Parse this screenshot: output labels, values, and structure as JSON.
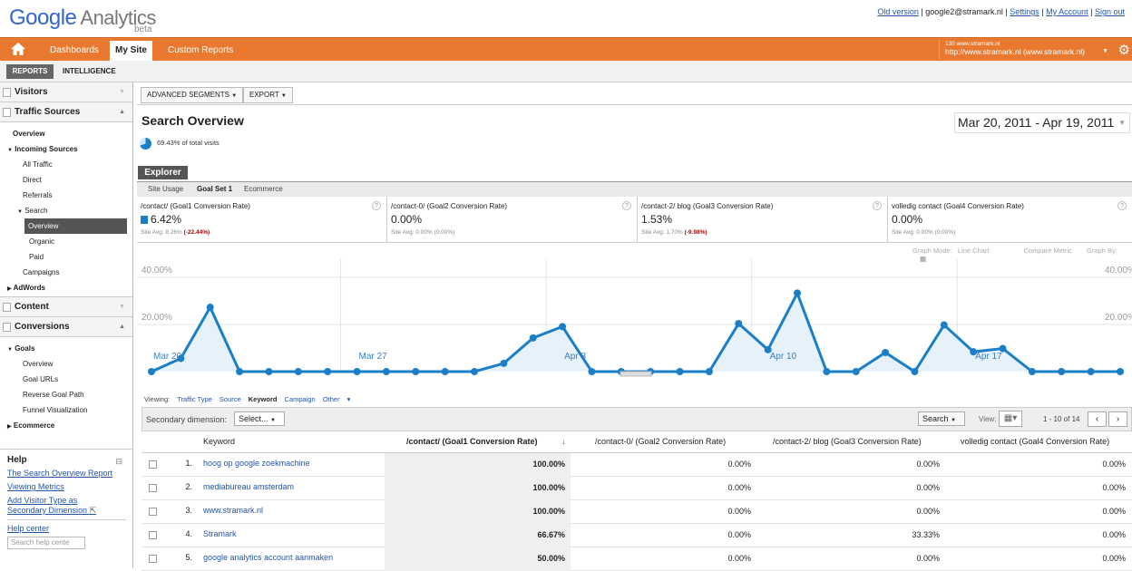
{
  "app": {
    "logo_google": "Google",
    "logo_analytics": "Analytics",
    "logo_beta": "beta"
  },
  "toplinks": {
    "old_version": "Old version",
    "email": "google2@stramark.nl",
    "settings": "Settings",
    "my_account": "My Account",
    "sign_out": "Sign out"
  },
  "nav": {
    "dashboards": "Dashboards",
    "my_site": "My Site",
    "custom_reports": "Custom Reports",
    "account_small": "130 www.stramark.nl",
    "account_big": "http://www.stramark.nl (www.stramark.nl)"
  },
  "subnav": {
    "reports": "REPORTS",
    "intelligence": "INTELLIGENCE"
  },
  "sidebar": {
    "visitors": "Visitors",
    "traffic_sources": "Traffic Sources",
    "overview": "Overview",
    "incoming_sources": "Incoming Sources",
    "all_traffic": "All Traffic",
    "direct": "Direct",
    "referrals": "Referrals",
    "search": "Search",
    "search_overview": "Overview",
    "organic": "Organic",
    "paid": "Paid",
    "campaigns": "Campaigns",
    "adwords": "AdWords",
    "content": "Content",
    "conversions": "Conversions",
    "goals": "Goals",
    "goals_overview": "Overview",
    "goal_urls": "Goal URLs",
    "reverse_goal_path": "Reverse Goal Path",
    "funnel_visualization": "Funnel Visualization",
    "ecommerce": "Ecommerce"
  },
  "help": {
    "title": "Help",
    "link1": "The Search Overview Report",
    "link2": "Viewing Metrics",
    "link3a": "Add Visitor Type as",
    "link3b": "Secondary Dimension",
    "help_center": "Help center",
    "search_placeholder": "Search help cente"
  },
  "toolbar": {
    "advanced_segments": "ADVANCED SEGMENTS",
    "export": "EXPORT"
  },
  "page": {
    "title": "Search Overview",
    "pie_text": "69.43% of total visits",
    "date_range": "Mar 20, 2011 - Apr 19, 2011"
  },
  "explorer": {
    "label": "Explorer",
    "tabs": [
      "Site Usage",
      "Goal Set 1",
      "Ecommerce"
    ]
  },
  "metrics": [
    {
      "label": "/contact/ (Goal1 Conversion Rate)",
      "value": "6.42%",
      "avg": "Site Avg: 8.26% ",
      "delta": "(-22.44%)"
    },
    {
      "label": "/contact-0/ (Goal2 Conversion Rate)",
      "value": "0.00%",
      "avg": "Site Avg: 0.00% (0.00%)",
      "delta": ""
    },
    {
      "label": "/contact-2/ blog (Goal3 Conversion Rate)",
      "value": "1.53%",
      "avg": "Site Avg: 1.70% ",
      "delta": "(-9.98%)"
    },
    {
      "label": "volledig contact (Goal4 Conversion Rate)",
      "value": "0.00%",
      "avg": "Site Avg: 0.00% (0.00%)",
      "delta": ""
    }
  ],
  "graph_opts": {
    "mode": "Graph Mode:",
    "line": "Line Chart",
    "compare": "Compare Metric",
    "by": "Graph By:"
  },
  "chart_data": {
    "type": "line",
    "series": [
      {
        "name": "/contact/ (Goal1 Conversion Rate)",
        "values": [
          0,
          5.6,
          27.3,
          0,
          0,
          0,
          0,
          0,
          0,
          0,
          0,
          0,
          3.5,
          14.3,
          19.1,
          0,
          0,
          0,
          0,
          0,
          20.4,
          9.3,
          33.3,
          0,
          0,
          8.1,
          0,
          19.8,
          8.4,
          9.8,
          0,
          0,
          0,
          0
        ]
      }
    ],
    "x_labels": [
      "Mar 20",
      "Mar 27",
      "Apr 3",
      "Apr 10",
      "Apr 17"
    ],
    "y_ticks": [
      "20.00%",
      "40.00%"
    ],
    "ylim": [
      0,
      40
    ],
    "color": "#1a7fc7"
  },
  "viewing": {
    "label": "Viewing:",
    "opts": [
      "Traffic Type",
      "Source",
      "Keyword",
      "Campaign",
      "Other"
    ]
  },
  "table": {
    "secondary_dimension": "Secondary dimension:",
    "select": "Select...",
    "search": "Search",
    "view": "View:",
    "pager": "1 - 10 of 14",
    "headers": [
      "Keyword",
      "/contact/ (Goal1 Conversion Rate)",
      "/contact-0/ (Goal2 Conversion Rate)",
      "/contact-2/ blog (Goal3 Conversion Rate)",
      "volledig contact (Goal4 Conversion Rate)"
    ],
    "rows": [
      {
        "n": "1.",
        "kw": "hoog op google zoekmachine",
        "c1": "100.00%",
        "c2": "0.00%",
        "c3": "0.00%",
        "c4": "0.00%"
      },
      {
        "n": "2.",
        "kw": "mediabureau amsterdam",
        "c1": "100.00%",
        "c2": "0.00%",
        "c3": "0.00%",
        "c4": "0.00%"
      },
      {
        "n": "3.",
        "kw": "www.stramark.nl",
        "c1": "100.00%",
        "c2": "0.00%",
        "c3": "0.00%",
        "c4": "0.00%"
      },
      {
        "n": "4.",
        "kw": "Stramark",
        "c1": "66.67%",
        "c2": "0.00%",
        "c3": "33.33%",
        "c4": "0.00%"
      },
      {
        "n": "5.",
        "kw": "google analytics account aanmaken",
        "c1": "50.00%",
        "c2": "0.00%",
        "c3": "0.00%",
        "c4": "0.00%"
      }
    ]
  }
}
